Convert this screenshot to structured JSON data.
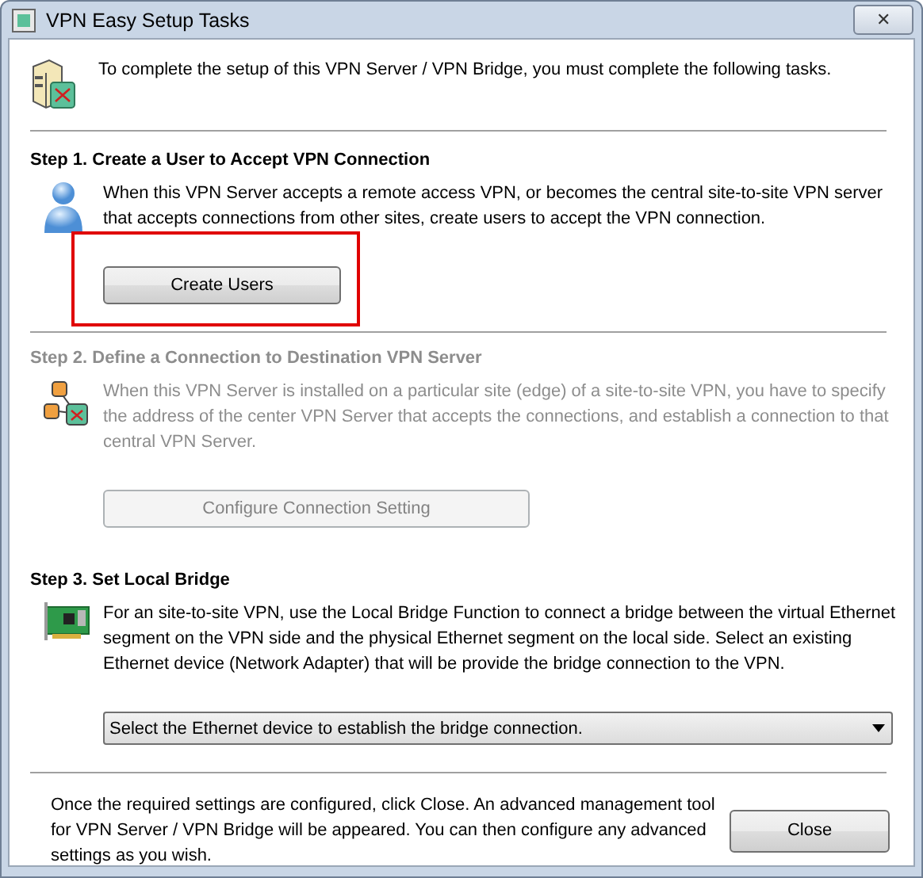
{
  "window": {
    "title": "VPN Easy Setup Tasks",
    "close": "✕"
  },
  "intro": "To complete the setup of this VPN Server / VPN Bridge, you must complete the following tasks.",
  "steps": [
    {
      "title": "Step 1. Create a User to Accept VPN Connection",
      "text": "When this VPN Server accepts a remote access VPN, or becomes the central site-to-site VPN server that accepts connections from other sites, create users to accept the VPN connection.",
      "control": {
        "kind": "button",
        "label": "Create Users"
      },
      "disabled": false,
      "highlighted": true
    },
    {
      "title": "Step 2. Define a Connection to Destination VPN Server",
      "text": "When this VPN Server is installed on a particular site (edge) of a site-to-site VPN, you have to specify the address of the center VPN Server that accepts the connections, and establish a connection to that central VPN Server.",
      "control": {
        "kind": "button",
        "label": "Configure Connection Setting"
      },
      "disabled": true,
      "highlighted": false
    },
    {
      "title": "Step 3. Set Local Bridge",
      "text": "For an site-to-site VPN, use the Local Bridge Function to connect a bridge between the virtual Ethernet segment on the VPN side and the physical Ethernet segment on the local side. Select an existing Ethernet device (Network Adapter) that will be provide the bridge connection to the VPN.",
      "control": {
        "kind": "dropdown",
        "label": "Select the Ethernet device to establish the bridge connection."
      },
      "disabled": false,
      "highlighted": false
    }
  ],
  "footer": {
    "text": "Once the required settings are configured, click Close. An advanced management tool for VPN Server / VPN Bridge will be appeared. You can then configure any advanced settings as you wish.",
    "button": "Close"
  }
}
